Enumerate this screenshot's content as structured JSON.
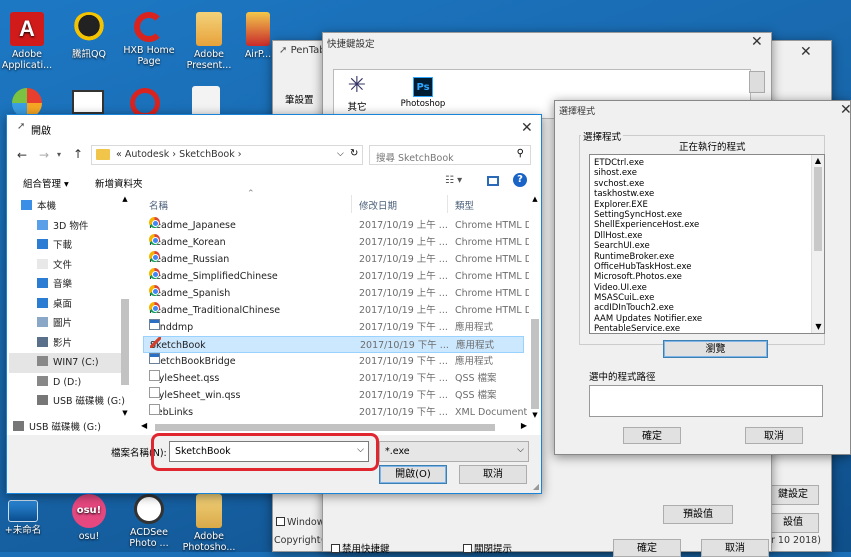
{
  "desktop": {
    "top_icons": [
      {
        "label": "Adobe Applicati...",
        "icon": "adobe-icon",
        "color": "#d11b1b"
      },
      {
        "label": "騰訊QQ",
        "icon": "qq-penguin-icon",
        "color": "#f5c400"
      },
      {
        "label": "HXB Home Page",
        "icon": "hxb-icon",
        "color": "#d9231f"
      },
      {
        "label": "Adobe Present...",
        "icon": "adobe-presenter-icon",
        "color": "#e8a23a"
      },
      {
        "label": "AirP...",
        "icon": "airp-icon",
        "color": "#c92b2b"
      }
    ],
    "bottom_icons": [
      {
        "label": "+未命名",
        "icon": "unnamed-icon"
      },
      {
        "label": "osu!",
        "icon": "osu-icon",
        "color": "#e5477f"
      },
      {
        "label": "ACDSee Photo ...",
        "icon": "acdsee-icon"
      },
      {
        "label": "Adobe Photosho...",
        "icon": "photoshop-folder-icon"
      }
    ]
  },
  "pentablet": {
    "title": "PenTab",
    "shortcut_title": "快捷鍵設定",
    "tab_other": "其它",
    "tab_photoshop": "Photoshop",
    "ps_badge": "Ps",
    "pen_settings": "筆設置",
    "window_check": "Window",
    "copyright": "Copyright©",
    "disable_shortcut": "禁用快捷鍵",
    "close_tip": "關閉提示",
    "default_button": "預設值",
    "ok_button": "確定",
    "cancel_button": "取消",
    "right_btn1": "鍵設定",
    "right_btn2": "設值",
    "version_text": "r 10 2018)"
  },
  "open_dialog": {
    "title": "開啟",
    "breadcrumb": [
      "«",
      "Autodesk",
      "SketchBook"
    ],
    "search_placeholder": "搜尋 SketchBook",
    "organize": "組合管理 ▾",
    "new_folder": "新增資料夾",
    "columns": {
      "name": "名稱",
      "date": "修改日期",
      "type": "類型"
    },
    "nav": [
      {
        "label": "本機",
        "icon": "computer-icon"
      },
      {
        "label": "3D 物件",
        "icon": "3d-objects-icon"
      },
      {
        "label": "下載",
        "icon": "download-icon"
      },
      {
        "label": "文件",
        "icon": "documents-icon"
      },
      {
        "label": "音樂",
        "icon": "music-icon"
      },
      {
        "label": "桌面",
        "icon": "desktop-icon"
      },
      {
        "label": "圖片",
        "icon": "pictures-icon"
      },
      {
        "label": "影片",
        "icon": "videos-icon"
      },
      {
        "label": "WIN7 (C:)",
        "icon": "drive-c-icon"
      },
      {
        "label": "D (D:)",
        "icon": "drive-d-icon"
      },
      {
        "label": "USB 磁碟機 (G:)",
        "icon": "usb-drive-icon"
      },
      {
        "label": "USB 磁碟機 (G:)",
        "icon": "usb-drive-icon"
      }
    ],
    "files": [
      {
        "name": "Readme_Japanese",
        "date": "2017/10/19 上午 ...",
        "type": "Chrome HTML D",
        "icon": "chrome-icon"
      },
      {
        "name": "Readme_Korean",
        "date": "2017/10/19 上午 ...",
        "type": "Chrome HTML D",
        "icon": "chrome-icon"
      },
      {
        "name": "Readme_Russian",
        "date": "2017/10/19 上午 ...",
        "type": "Chrome HTML D",
        "icon": "chrome-icon"
      },
      {
        "name": "Readme_SimplifiedChinese",
        "date": "2017/10/19 上午 ...",
        "type": "Chrome HTML D",
        "icon": "chrome-icon"
      },
      {
        "name": "Readme_Spanish",
        "date": "2017/10/19 上午 ...",
        "type": "Chrome HTML D",
        "icon": "chrome-icon"
      },
      {
        "name": "Readme_TraditionalChinese",
        "date": "2017/10/19 上午 ...",
        "type": "Chrome HTML D",
        "icon": "chrome-icon"
      },
      {
        "name": "senddmp",
        "date": "2017/10/19 下午 ...",
        "type": "應用程式",
        "icon": "app-icon"
      },
      {
        "name": "SketchBook",
        "date": "2017/10/19 下午 ...",
        "type": "應用程式",
        "icon": "sketchbook-icon"
      },
      {
        "name": "SketchBookBridge",
        "date": "2017/10/19 下午 ...",
        "type": "應用程式",
        "icon": "app-icon"
      },
      {
        "name": "StyleSheet.qss",
        "date": "2017/10/19 下午 ...",
        "type": "QSS 檔案",
        "icon": "file-icon"
      },
      {
        "name": "StyleSheet_win.qss",
        "date": "2017/10/19 下午 ...",
        "type": "QSS 檔案",
        "icon": "file-icon"
      },
      {
        "name": "webLinks",
        "date": "2017/10/19 下午 ...",
        "type": "XML Document",
        "icon": "file-icon"
      }
    ],
    "selected_file": "SketchBook",
    "filename_label": "檔案名稱(N):",
    "filename_value": "SketchBook",
    "filter_value": "*.exe",
    "open_button": "開啟(O)",
    "cancel_button": "取消"
  },
  "choose_program": {
    "title": "選擇程式",
    "group_label": "選擇程式",
    "running_label": "正在執行的程式",
    "processes": [
      "ETDCtrl.exe",
      "sihost.exe",
      "svchost.exe",
      "taskhostw.exe",
      "Explorer.EXE",
      "SettingSyncHost.exe",
      "ShellExperienceHost.exe",
      "DllHost.exe",
      "SearchUI.exe",
      "RuntimeBroker.exe",
      "OfficeHubTaskHost.exe",
      "Microsoft.Photos.exe",
      "Video.UI.exe",
      "MSASCuiL.exe",
      "acdIDInTouch2.exe",
      "AAM Updates Notifier.exe",
      "PentableService.exe"
    ],
    "browse_button": "瀏覽",
    "path_label": "選中的程式路徑",
    "ok_button": "確定",
    "cancel_button": "取消"
  },
  "colors": {
    "highlight_red": "#e0262f",
    "selection_blue": "#cce8ff",
    "desktop_blue": "#1a6fb6"
  }
}
